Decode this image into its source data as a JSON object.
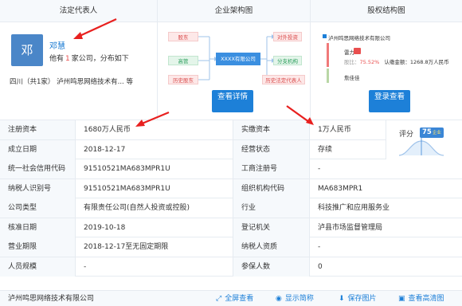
{
  "panels": {
    "legal_rep_title": "法定代表人",
    "org_title": "企业架构图",
    "share_title": "股权结构图"
  },
  "legal_rep": {
    "avatar_char": "邓",
    "name": "邓慧",
    "desc_prefix": "他有",
    "desc_count": "1",
    "desc_suffix": "家公司，分布如下",
    "location": "四川（共1家）",
    "company_short": "泸州鸣思网络技术有...",
    "more": "等"
  },
  "org_chart": {
    "center": "XXXX有限公司",
    "left_top": "股东",
    "left_mid": "高管",
    "left_bottom": "历史股东",
    "right_top": "对外投资",
    "right_mid": "分支机构",
    "right_bottom": "历史法定代表人",
    "button_label": "查看详情"
  },
  "share_chart": {
    "company": "泸州鸣思网络技术有限公司",
    "holder1": "雷力",
    "holder1_ratio_label": "股比：",
    "holder1_ratio": "75.52%",
    "holder1_amount": "认缴金额：1268.8万人民币",
    "holder2": "詹佳佳",
    "button_label": "登录查看"
  },
  "table": [
    {
      "l1": "注册资本",
      "v1": "1680万人民币",
      "l2": "实缴资本",
      "v2": "1万人民币"
    },
    {
      "l1": "成立日期",
      "v1": "2018-12-17",
      "l2": "经营状态",
      "v2": "存续"
    },
    {
      "l1": "统一社会信用代码",
      "v1": "91510521MA683MPR1U",
      "l2": "工商注册号",
      "v2": "-"
    },
    {
      "l1": "纳税人识别号",
      "v1": "91510521MA683MPR1U",
      "l2": "组织机构代码",
      "v2": "MA683MPR1"
    },
    {
      "l1": "公司类型",
      "v1": "有限责任公司(自然人投资或控股)",
      "l2": "行业",
      "v2": "科技推广和应用服务业"
    },
    {
      "l1": "核准日期",
      "v1": "2019-10-18",
      "l2": "登记机关",
      "v2": "泸县市场监督管理局"
    },
    {
      "l1": "营业期限",
      "v1": "2018-12-17至无固定期限",
      "l2": "纳税人资质",
      "v2": "-"
    },
    {
      "l1": "人员规模",
      "v1": "-",
      "l2": "参保人数",
      "v2": "0"
    }
  ],
  "score": {
    "label": "评分",
    "value": "75",
    "tag": "企业"
  },
  "footer": {
    "company": "泸州鸣思网络技术有限公司",
    "full_screen": "全屏查看",
    "show_short": "显示简称",
    "save_image": "保存图片",
    "view_hd": "查看高清图"
  },
  "colors": {
    "accent": "#1d80d8",
    "highlight": "#e94f4f",
    "label_bg": "#f6f9fc",
    "arrow": "#e8201f"
  }
}
